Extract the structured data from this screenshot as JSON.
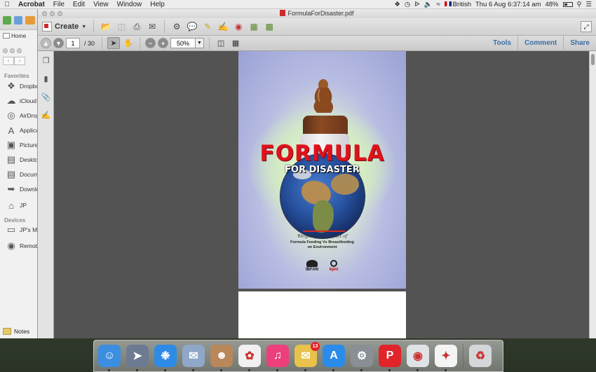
{
  "menubar": {
    "app_name": "Acrobat",
    "items": [
      "File",
      "Edit",
      "View",
      "Window",
      "Help"
    ],
    "input_source": "British",
    "clock": "Thu 6 Aug  6:37:14 am",
    "battery": "48%",
    "battery_level": 0.48
  },
  "finder": {
    "tab_label": "Home",
    "favorites_heading": "Favorites",
    "favorites": [
      {
        "label": "Dropbox",
        "icon": "dropbox-icon"
      },
      {
        "label": "iCloud Drive",
        "icon": "cloud-icon"
      },
      {
        "label": "AirDrop",
        "icon": "airdrop-icon"
      },
      {
        "label": "Applications",
        "icon": "applications-icon"
      },
      {
        "label": "Pictures",
        "icon": "camera-icon"
      },
      {
        "label": "Desktop",
        "icon": "desktop-icon"
      },
      {
        "label": "Documents",
        "icon": "document-icon"
      },
      {
        "label": "Downloads",
        "icon": "download-icon"
      },
      {
        "label": "JP",
        "icon": "home-icon"
      }
    ],
    "devices_heading": "Devices",
    "devices": [
      {
        "label": "JP's MacBook",
        "icon": "laptop-icon"
      },
      {
        "label": "Remote Disc",
        "icon": "disc-icon"
      }
    ],
    "notes_label": "Notes"
  },
  "acrobat": {
    "window_title": "FormulaForDisaster.pdf",
    "create_label": "Create",
    "current_page": "1",
    "page_total": "/ 30",
    "zoom": "50%",
    "panels": [
      "Tools",
      "Comment",
      "Share"
    ]
  },
  "cover": {
    "title": "FORMULA",
    "subtitle": "FOR DISASTER",
    "tagline": "Weighing the Impact of",
    "line1": "Formula Feeding Vs Breastfeeding",
    "line2": "on Environment",
    "logo1": "IBFAN",
    "logo2": "bpni"
  },
  "dock": {
    "apps": [
      {
        "name": "finder",
        "color": "#3b8ee0"
      },
      {
        "name": "launchpad",
        "color": "#6d7b92"
      },
      {
        "name": "safari",
        "color": "#2d8be6"
      },
      {
        "name": "mail-stamp",
        "color": "#8fa7c8"
      },
      {
        "name": "contacts",
        "color": "#b8875a"
      },
      {
        "name": "photos",
        "color": "#f0f0f0"
      },
      {
        "name": "itunes",
        "color": "#ec3f7c"
      },
      {
        "name": "mail",
        "color": "#e8c24a",
        "badge": "13"
      },
      {
        "name": "app-store",
        "color": "#2a8ce8"
      },
      {
        "name": "system-preferences",
        "color": "#8a8f96"
      },
      {
        "name": "polaris",
        "color": "#e0242a"
      },
      {
        "name": "chrome",
        "color": "#dfe3e6"
      },
      {
        "name": "acrobat",
        "color": "#f4f4f4"
      },
      {
        "name": "trash",
        "color": "#d4d7da"
      }
    ]
  }
}
